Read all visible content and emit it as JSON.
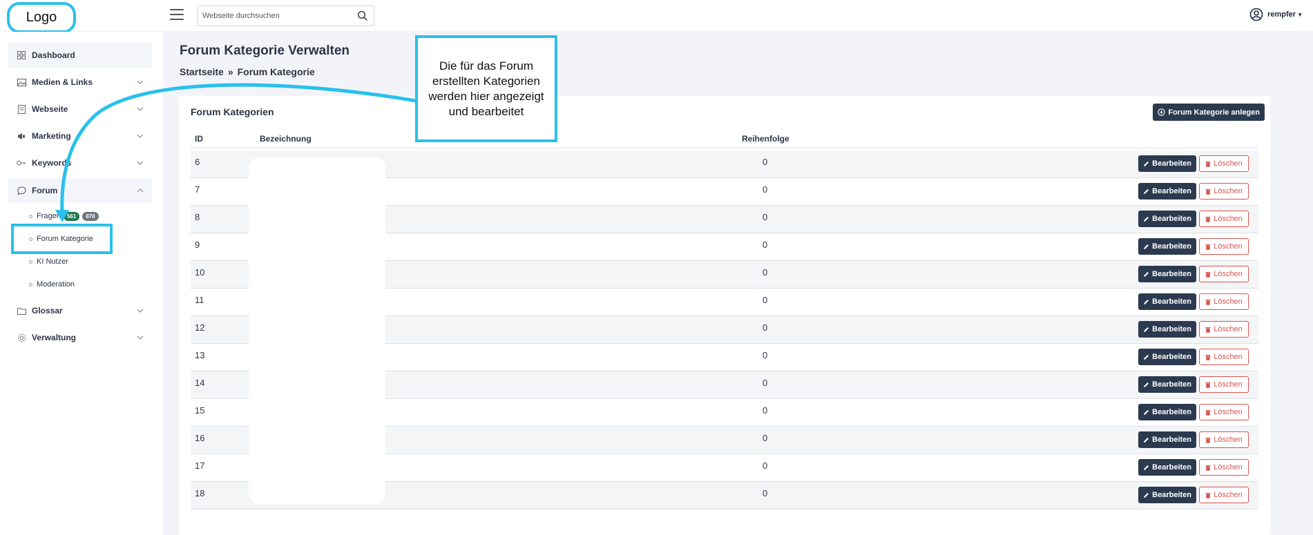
{
  "topbar": {
    "logo": "Logo",
    "search_placeholder": "Webseite durchsuchen",
    "user_name": "rempfer"
  },
  "sidebar": {
    "items": [
      {
        "label": "Dashboard",
        "icon": "grid-icon"
      },
      {
        "label": "Medien & Links",
        "icon": "image-icon"
      },
      {
        "label": "Webseite",
        "icon": "page-icon"
      },
      {
        "label": "Marketing",
        "icon": "megaphone-icon"
      },
      {
        "label": "Keywords",
        "icon": "key-icon"
      },
      {
        "label": "Forum",
        "icon": "chat-icon"
      },
      {
        "label": "Glossar",
        "icon": "folder-icon"
      },
      {
        "label": "Verwaltung",
        "icon": "gear-icon"
      }
    ],
    "forum_sub": [
      {
        "label": "Fragen",
        "badge_green": "561",
        "badge_grey": "870"
      },
      {
        "label": "Forum Kategorie"
      },
      {
        "label": "KI Nutzer"
      },
      {
        "label": "Moderation"
      }
    ]
  },
  "main": {
    "title": "Forum Kategorie Verwalten",
    "breadcrumb_home": "Startseite",
    "breadcrumb_sep": "»",
    "breadcrumb_current": "Forum Kategorie",
    "card_title": "Forum Kategorien",
    "add_button": "Forum Kategorie anlegen",
    "columns": {
      "id": "ID",
      "name": "Bezeichnung",
      "order": "Reihenfolge"
    },
    "edit_label": "Bearbeiten",
    "delete_label": "Löschen",
    "rows": [
      {
        "id": "6",
        "order": "0"
      },
      {
        "id": "7",
        "order": "0"
      },
      {
        "id": "8",
        "order": "0"
      },
      {
        "id": "9",
        "order": "0"
      },
      {
        "id": "10",
        "order": "0"
      },
      {
        "id": "11",
        "order": "0"
      },
      {
        "id": "12",
        "order": "0"
      },
      {
        "id": "13",
        "order": "0"
      },
      {
        "id": "14",
        "order": "0"
      },
      {
        "id": "15",
        "order": "0"
      },
      {
        "id": "16",
        "order": "0"
      },
      {
        "id": "17",
        "order": "0"
      },
      {
        "id": "18",
        "order": "0"
      }
    ]
  },
  "annotation": {
    "text": "Die für das Forum erstellten Kategorien werden hier angezeigt und bearbeitet"
  },
  "colors": {
    "accent": "#29c0ec",
    "dark_button": "#2c3a4f",
    "danger": "#d9534f"
  }
}
